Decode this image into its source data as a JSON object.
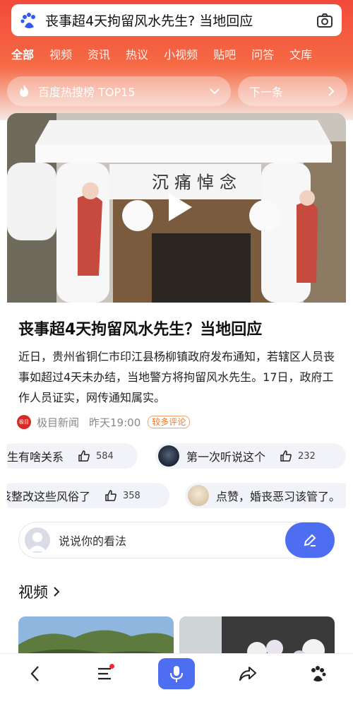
{
  "search": {
    "query": "丧事超4天拘留风水先生? 当地回应"
  },
  "tabs": [
    {
      "label": "全部",
      "active": true
    },
    {
      "label": "视频"
    },
    {
      "label": "资讯"
    },
    {
      "label": "热议"
    },
    {
      "label": "小视频"
    },
    {
      "label": "贴吧"
    },
    {
      "label": "问答"
    },
    {
      "label": "文库"
    }
  ],
  "hot_list": {
    "label": "百度热搜榜 TOP15"
  },
  "next_button": {
    "label": "下一条"
  },
  "article": {
    "video_caption": "沉痛悼念",
    "title": "丧事超4天拘留风水先生？当地回应",
    "summary": "近日，贵州省铜仁市印江县杨柳镇政府发布通知，若辖区人员丧事如超过4天未办结，当地警方将拘留风水先生。17日，政府工作人员证实，网传通知属实。",
    "source_logo_text": "极目",
    "source": "极目新闻",
    "time": "昨天19:00",
    "badge": "较多评论"
  },
  "comments": [
    {
      "text": "生有啥关系",
      "likes": "584"
    },
    {
      "text": "第一次听说这个",
      "likes": "232"
    },
    {
      "text": "该整改这些风俗了",
      "likes": "358"
    },
    {
      "text": "点赞，婚丧恶习该管了。",
      "likes": ""
    }
  ],
  "comment_input": {
    "placeholder": "说说你的看法"
  },
  "videos_section": {
    "title": "视频"
  },
  "colors": {
    "brand_red": "#f34a3a",
    "accent_blue": "#4e6ef2",
    "badge_orange": "#ef7a2f"
  }
}
